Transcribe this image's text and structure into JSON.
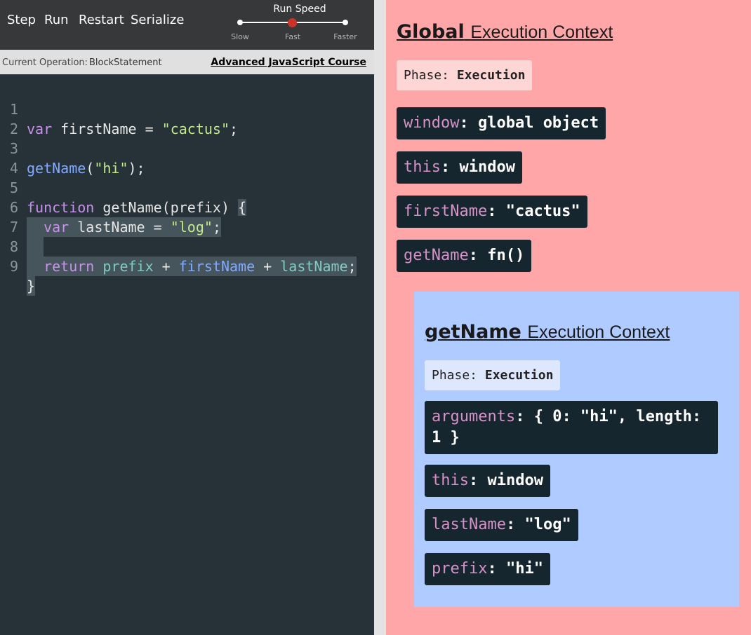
{
  "toolbar": {
    "step_label": "Step",
    "run_label": "Run",
    "restart_label": "Restart",
    "serialize_label": "Serialize",
    "speed_title": "Run Speed",
    "speed_options": [
      "Slow",
      "Fast",
      "Faster"
    ],
    "speed_selected": "Fast",
    "speed_knob_color": "#c8352a"
  },
  "operation": {
    "label": "Current Operation:",
    "value": "BlockStatement",
    "course_link": "Advanced JavaScript Course"
  },
  "code": {
    "lines": [
      {
        "num": "1",
        "text": "var firstName = \"cactus\";"
      },
      {
        "num": "2",
        "text": ""
      },
      {
        "num": "3",
        "text": "getName(\"hi\");"
      },
      {
        "num": "4",
        "text": ""
      },
      {
        "num": "5",
        "text": "function getName(prefix) {"
      },
      {
        "num": "6",
        "text": "  var lastName = \"log\";"
      },
      {
        "num": "7",
        "text": ""
      },
      {
        "num": "8",
        "text": "  return prefix + firstName + lastName;"
      },
      {
        "num": "9",
        "text": "}"
      }
    ]
  },
  "global_context": {
    "title_bold": "Global",
    "title_rest": "Execution Context",
    "phase_label": "Phase:",
    "phase_value": "Execution",
    "bg_color": "#ffa7a8",
    "variables": [
      {
        "key": "window",
        "value": ": global object"
      },
      {
        "key": "this",
        "value": ": window"
      },
      {
        "key": "firstName",
        "value": ": \"cactus\""
      },
      {
        "key": "getName",
        "value": ": fn()"
      }
    ]
  },
  "function_context": {
    "title_bold": "getName",
    "title_rest": "Execution Context",
    "phase_label": "Phase:",
    "phase_value": "Execution",
    "bg_color": "#b0cbff",
    "variables": [
      {
        "key": "arguments",
        "value": ": { 0: \"hi\", length:",
        "value_line2": "1 }"
      },
      {
        "key": "this",
        "value": ": window"
      },
      {
        "key": "lastName",
        "value": ": \"log\""
      },
      {
        "key": "prefix",
        "value": ": \"hi\""
      }
    ]
  }
}
